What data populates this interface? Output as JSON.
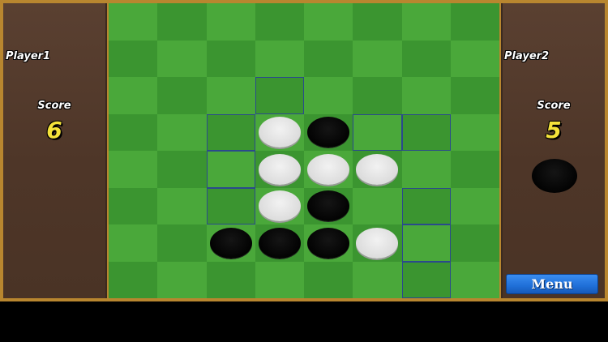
{
  "player1": {
    "name": "Player1",
    "score_label": "Score",
    "score": "6"
  },
  "player2": {
    "name": "Player2",
    "score_label": "Score",
    "score": "5"
  },
  "current_turn": "black",
  "menu_label": "Menu",
  "colors": {
    "light_square": "#4aa83a",
    "dark_square": "#3b9530",
    "hint_border": "#2a4a8c",
    "score_text": "#f4e23a",
    "menu_button": "#1f6fd8"
  },
  "board": [
    [
      "",
      "",
      "",
      "",
      "",
      "",
      "",
      ""
    ],
    [
      "",
      "",
      "",
      "",
      "",
      "",
      "",
      ""
    ],
    [
      "",
      "",
      "",
      "hint",
      "",
      "",
      "",
      ""
    ],
    [
      "",
      "",
      "hint",
      "white",
      "black",
      "hint",
      "hint",
      ""
    ],
    [
      "",
      "",
      "hint",
      "white",
      "white",
      "white",
      "",
      ""
    ],
    [
      "",
      "",
      "hint",
      "white",
      "black",
      "",
      "hint",
      ""
    ],
    [
      "",
      "",
      "black",
      "black",
      "black",
      "white",
      "hint",
      ""
    ],
    [
      "",
      "",
      "",
      "",
      "",
      "",
      "hint",
      ""
    ]
  ]
}
